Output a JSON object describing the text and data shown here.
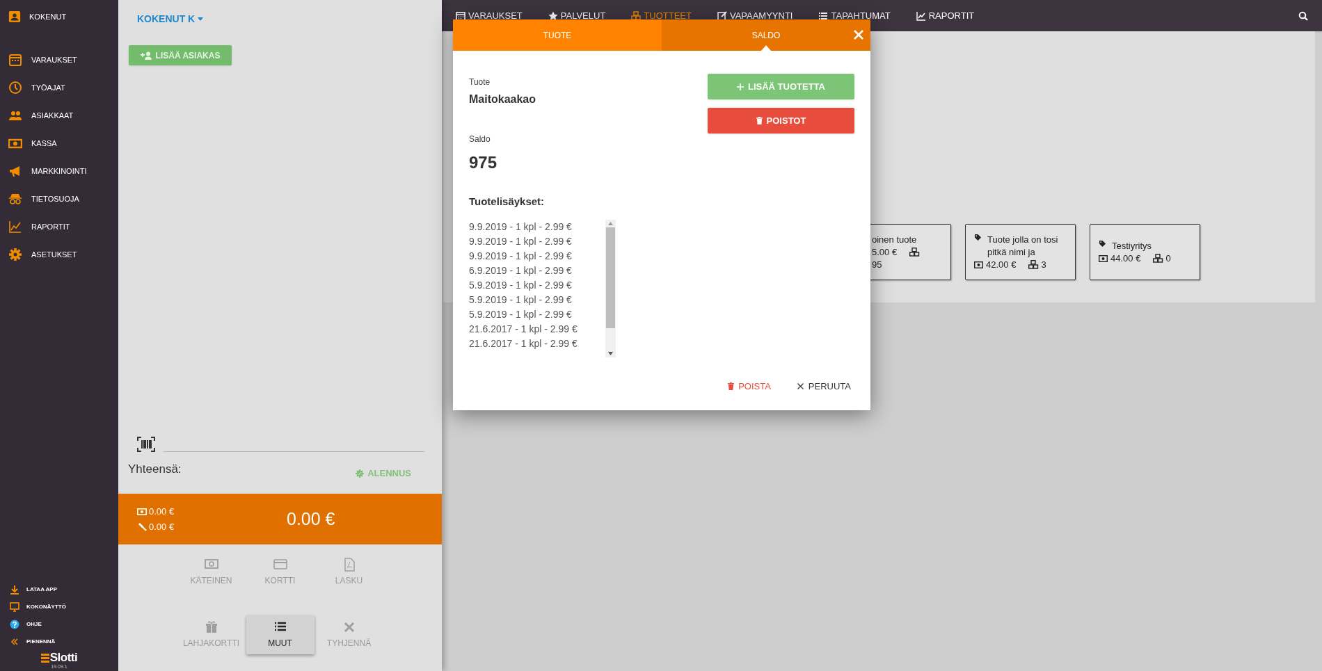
{
  "sidebar": {
    "user": "KOKENUT",
    "items": [
      {
        "label": "VARAUKSET"
      },
      {
        "label": "TYÖAJAT"
      },
      {
        "label": "ASIAKKAAT"
      },
      {
        "label": "KASSA"
      },
      {
        "label": "MARKKINOINTI"
      },
      {
        "label": "TIETOSUOJA"
      },
      {
        "label": "RAPORTIT"
      },
      {
        "label": "ASETUKSET"
      }
    ],
    "footer_items": [
      {
        "label": "LATAA APP"
      },
      {
        "label": "KOKONÄYTTÖ"
      },
      {
        "label": "OHJE"
      },
      {
        "label": "PIENENNÄ"
      }
    ],
    "brand": "Slotti",
    "version": "19.09.1"
  },
  "left_panel": {
    "customer_menu": "KOKENUT K",
    "add_customer": "LISÄÄ ASIAKAS",
    "total_label": "Yhteensä:",
    "discount": "ALENNUS",
    "summary": {
      "cash": "0.00 €",
      "other": "0.00 €",
      "total": "0.00 €"
    },
    "payment_buttons": [
      {
        "label": "KÄTEINEN",
        "disabled": true,
        "selected": false
      },
      {
        "label": "KORTTI",
        "disabled": true,
        "selected": false
      },
      {
        "label": "LASKU",
        "disabled": true,
        "selected": false
      },
      {
        "label": "LAHJAKORTTI",
        "disabled": true,
        "selected": false
      },
      {
        "label": "MUUT",
        "disabled": false,
        "selected": true
      },
      {
        "label": "TYHJENNÄ",
        "disabled": true,
        "selected": false
      }
    ]
  },
  "nav": {
    "tabs": [
      {
        "label": "VARAUKSET",
        "selected": false
      },
      {
        "label": "PALVELUT",
        "selected": false
      },
      {
        "label": "TUOTTEET",
        "selected": true
      },
      {
        "label": "VAPAAMYYNTI",
        "selected": false
      },
      {
        "label": "TAPAHTUMAT",
        "selected": false
      },
      {
        "label": "RAPORTIT",
        "selected": false
      }
    ]
  },
  "products": [
    {
      "name": "oinen tuote",
      "price": "5.00 €",
      "stock": "95",
      "clipped": true
    },
    {
      "name": "Tuote jolla on tosi pitkä nimi ja",
      "price": "42.00 €",
      "stock": "3",
      "clipped": false
    },
    {
      "name": "Testiyritys",
      "price": "44.00 €",
      "stock": "0",
      "clipped": false
    }
  ],
  "dialog": {
    "tabs": [
      {
        "label": "TUOTE",
        "selected": false
      },
      {
        "label": "SALDO",
        "selected": true
      }
    ],
    "product_label": "Tuote",
    "product": "Maitokaakao",
    "balance_label": "Saldo",
    "balance": "975",
    "history_title": "Tuotelisäykset:",
    "history": [
      "9.9.2019 - 1 kpl - 2.99 €",
      "9.9.2019 - 1 kpl - 2.99 €",
      "9.9.2019 - 1 kpl - 2.99 €",
      "6.9.2019 - 1 kpl - 2.99 €",
      "5.9.2019 - 1 kpl - 2.99 €",
      "5.9.2019 - 1 kpl - 2.99 €",
      "5.9.2019 - 1 kpl - 2.99 €",
      "21.6.2017 - 1 kpl - 2.99 €",
      "21.6.2017 - 1 kpl - 2.99 €"
    ],
    "add_button": "LISÄÄ TUOTETTA",
    "removals_button": "POISTOT",
    "delete_button": "POISTA",
    "cancel_button": "PERUUTA"
  }
}
